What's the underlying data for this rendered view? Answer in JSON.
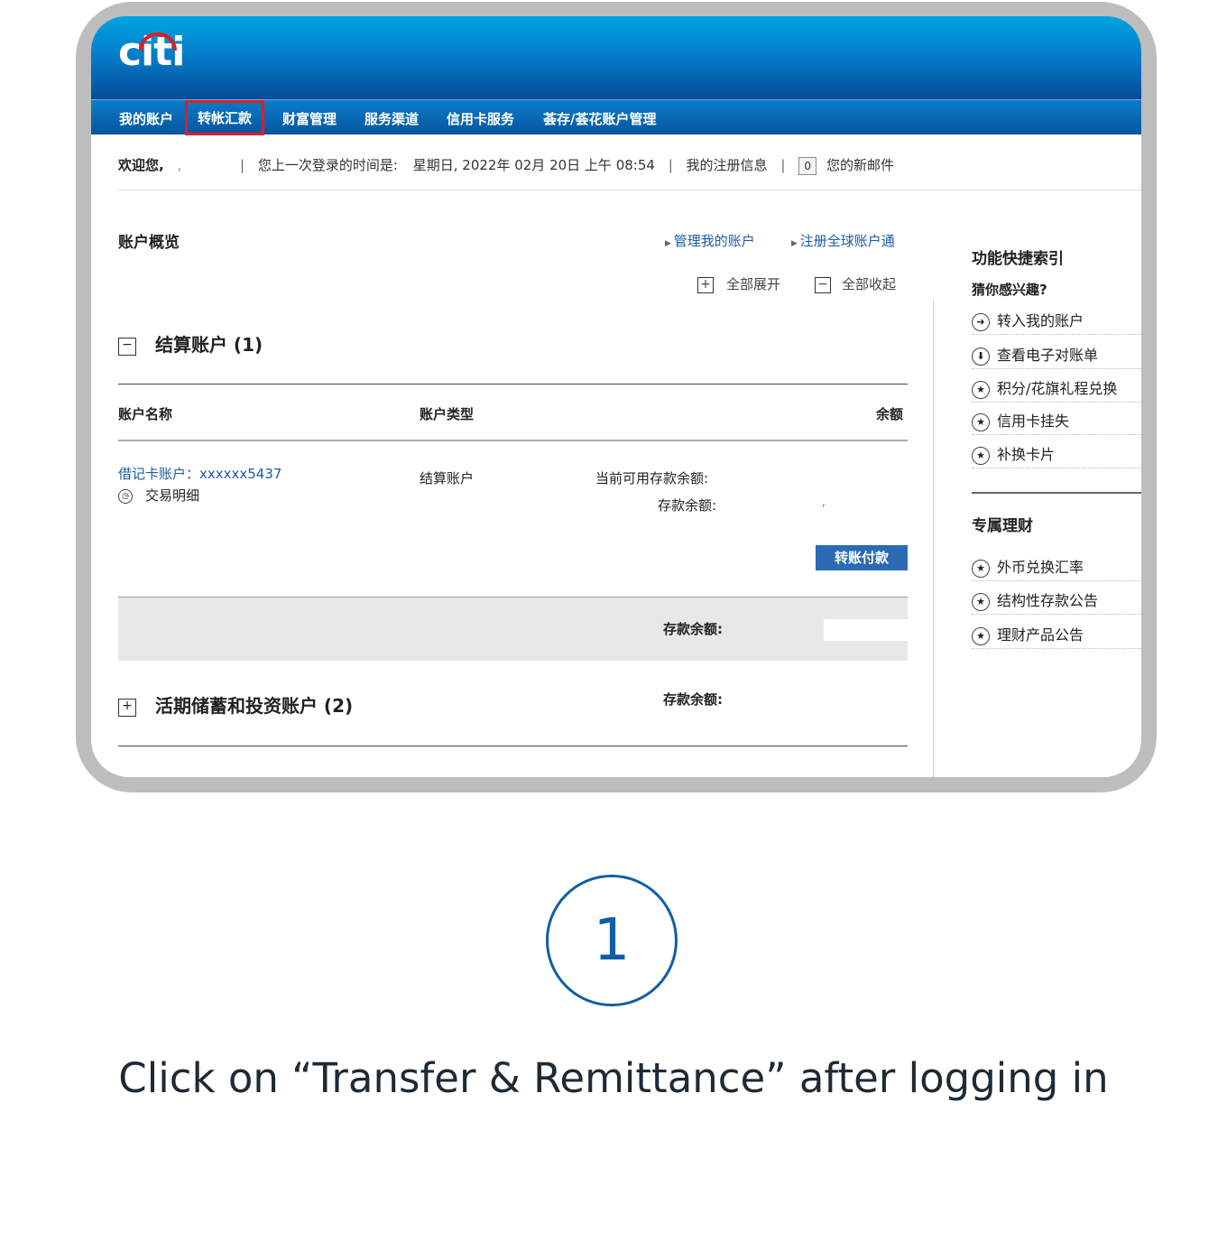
{
  "brand": {
    "logo_text": "citi",
    "accent": "#e31b23",
    "blue": "#0576c4"
  },
  "nav": {
    "items": [
      "我的账户",
      "转帐汇款",
      "财富管理",
      "服务渠道",
      "信用卡服务",
      "荟存/荟花账户管理"
    ],
    "active_index": 1
  },
  "welcome": {
    "greeting": "欢迎您,",
    "name_punct": ",",
    "last_login_label": "您上一次登录的时间是:",
    "last_login_value": "星期日, 2022年 02月 20日 上午 08:54",
    "registration": "我的注册信息",
    "mail_count": "0",
    "mail_label": "您的新邮件"
  },
  "overview": {
    "title": "账户概览",
    "manage_link": "管理我的账户",
    "register_link": "注册全球账户通",
    "expand_all": "全部展开",
    "collapse_all": "全部收起"
  },
  "settlement": {
    "title": "结算账户 (1)",
    "columns": [
      "账户名称",
      "账户类型",
      "余额"
    ],
    "row": {
      "account_name": "借记卡账户：xxxxxx5437",
      "details_link": "交易明细",
      "type": "结算账户",
      "available_label": "当前可用存款余额:",
      "deposit_label": "存款余额:",
      "deposit_value": ","
    },
    "transfer_button": "转账付款",
    "total_label": "存款余额:"
  },
  "savings": {
    "title": "活期储蓄和投资账户 (2)",
    "balance_label": "存款余额:"
  },
  "sidebar": {
    "title": "功能快捷索引",
    "subtitle": "猜你感兴趣?",
    "items": [
      "转入我的账户",
      "查看电子对账单",
      "积分/花旗礼程兑换",
      "信用卡挂失",
      "补换卡片"
    ],
    "section2_title": "专属理财",
    "items2": [
      "外币兑换汇率",
      "结构性存款公告",
      "理财产品公告"
    ]
  },
  "step": {
    "number": "1"
  },
  "caption": "Click on “Transfer & Remittance” after logging in"
}
